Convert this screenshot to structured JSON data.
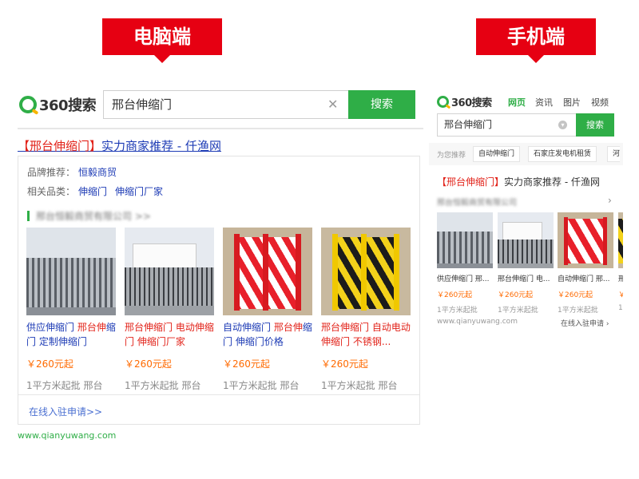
{
  "callouts": {
    "pc": "电脑端",
    "mobile": "手机端"
  },
  "pc": {
    "logo": "360搜索",
    "query": "邢台伸缩门",
    "clear_glyph": "✕",
    "search_button": "搜索",
    "result_title_highlight": "【邢台伸缩门】",
    "result_title_rest": "实力商家推荐 - 仟渔网",
    "brand_label": "品牌推荐：",
    "brand_value": "恒毅商贸",
    "related_label": "相关品类：",
    "related_items": [
      "伸缩门",
      "伸缩门厂家"
    ],
    "shop_name": "邢台恒毅商贸有限公司 >>",
    "products": [
      {
        "blue": "供应伸缩门 ",
        "red": "邢台伸",
        "blue2": "缩门 定制伸缩门",
        "price": "￥260元起",
        "meta": "1平方米起批    邢台"
      },
      {
        "blue": "",
        "red": "邢台伸缩门 ",
        "blue2": "电动伸缩门 伸缩门厂家",
        "price": "￥260元起",
        "meta": "1平方米起批    邢台"
      },
      {
        "blue": "自动伸缩门 ",
        "red": "邢台伸",
        "blue2": "缩门 伸缩门价格",
        "price": "￥260元起",
        "meta": "1平方米起批    邢台"
      },
      {
        "blue": "",
        "red": "邢台伸缩门 ",
        "blue2": "自动电动伸缩门 不锈钢...",
        "price": "￥260元起",
        "meta": "1平方米起批    邢台"
      }
    ],
    "apply_link": "在线入驻申请>>",
    "url": "www.qianyuwang.com"
  },
  "mobile": {
    "logo": "360搜索",
    "tabs": [
      "网页",
      "资讯",
      "图片",
      "视频"
    ],
    "active_tab": "网页",
    "query": "邢台伸缩门",
    "clear_glyph": "▾",
    "search_button": "搜索",
    "rec_label": "为您推荐",
    "rec_chips": [
      "自动伸缩门",
      "石家庄发电机租赁",
      "河"
    ],
    "result_title_highlight": "【邢台伸缩门】",
    "result_title_rest": "实力商家推荐 - 仟渔网",
    "shop_name": "邢台恒毅商贸有限公司",
    "chevron": "›",
    "products": [
      {
        "name": "供应伸缩门 邢...",
        "price": "￥260元起",
        "meta": "1平方米起批"
      },
      {
        "name": "邢台伸缩门 电...",
        "price": "￥260元起",
        "meta": "1平方米起批"
      },
      {
        "name": "自动伸缩门 邢...",
        "price": "￥260元起",
        "meta": "1平方米起批"
      },
      {
        "name": "邢",
        "price": "￥",
        "meta": "1"
      }
    ],
    "url": "www.qianyuwang.com",
    "apply_link": "在线入驻申请 ›"
  },
  "colors": {
    "brand_green": "#2fae47",
    "callout_red": "#e60012",
    "link_blue": "#1d3bb5",
    "price_orange": "#ff6a00"
  }
}
